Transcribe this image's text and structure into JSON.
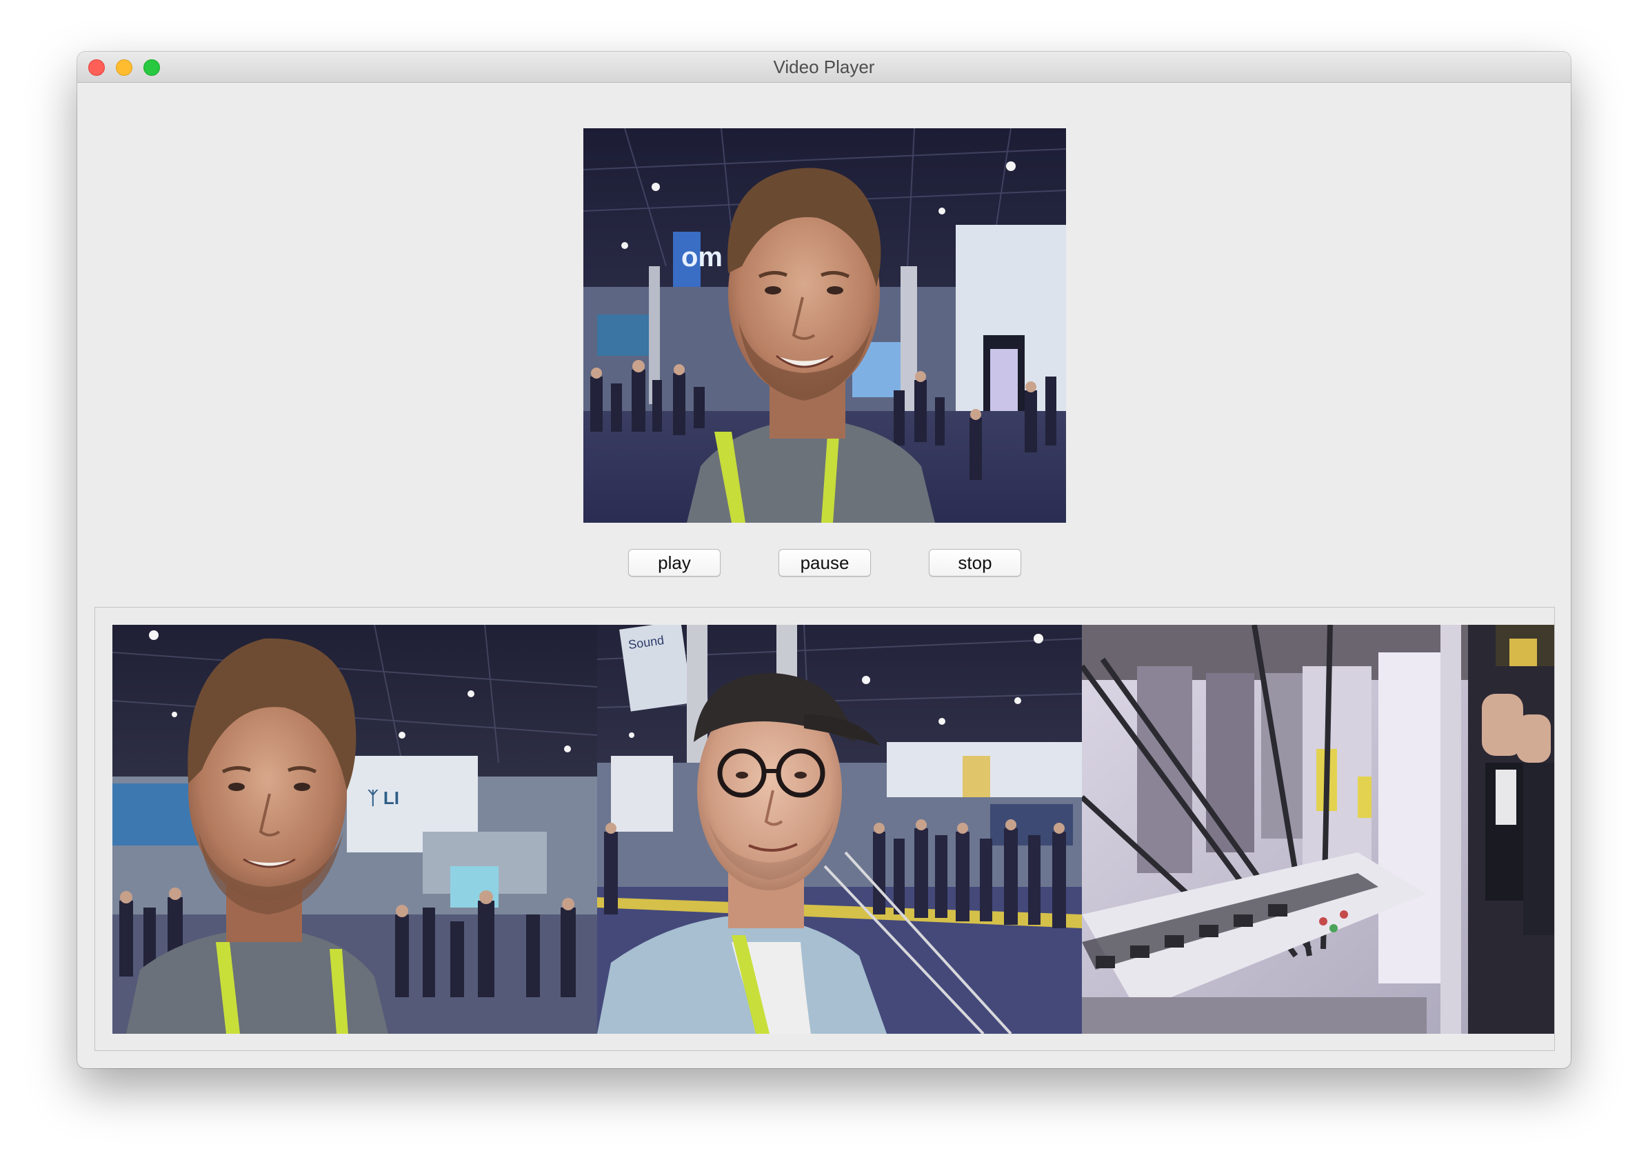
{
  "window": {
    "title": "Video Player"
  },
  "controls": {
    "play_label": "play",
    "pause_label": "pause",
    "stop_label": "stop"
  },
  "main_video": {
    "description_icon": "video-frame"
  },
  "thumbnails": [
    {
      "name": "thumbnail-1"
    },
    {
      "name": "thumbnail-2"
    },
    {
      "name": "thumbnail-3"
    }
  ],
  "colors": {
    "close": "#fe5f57",
    "minimize": "#febc2e",
    "zoom": "#28c840",
    "window_bg": "#ececec"
  }
}
